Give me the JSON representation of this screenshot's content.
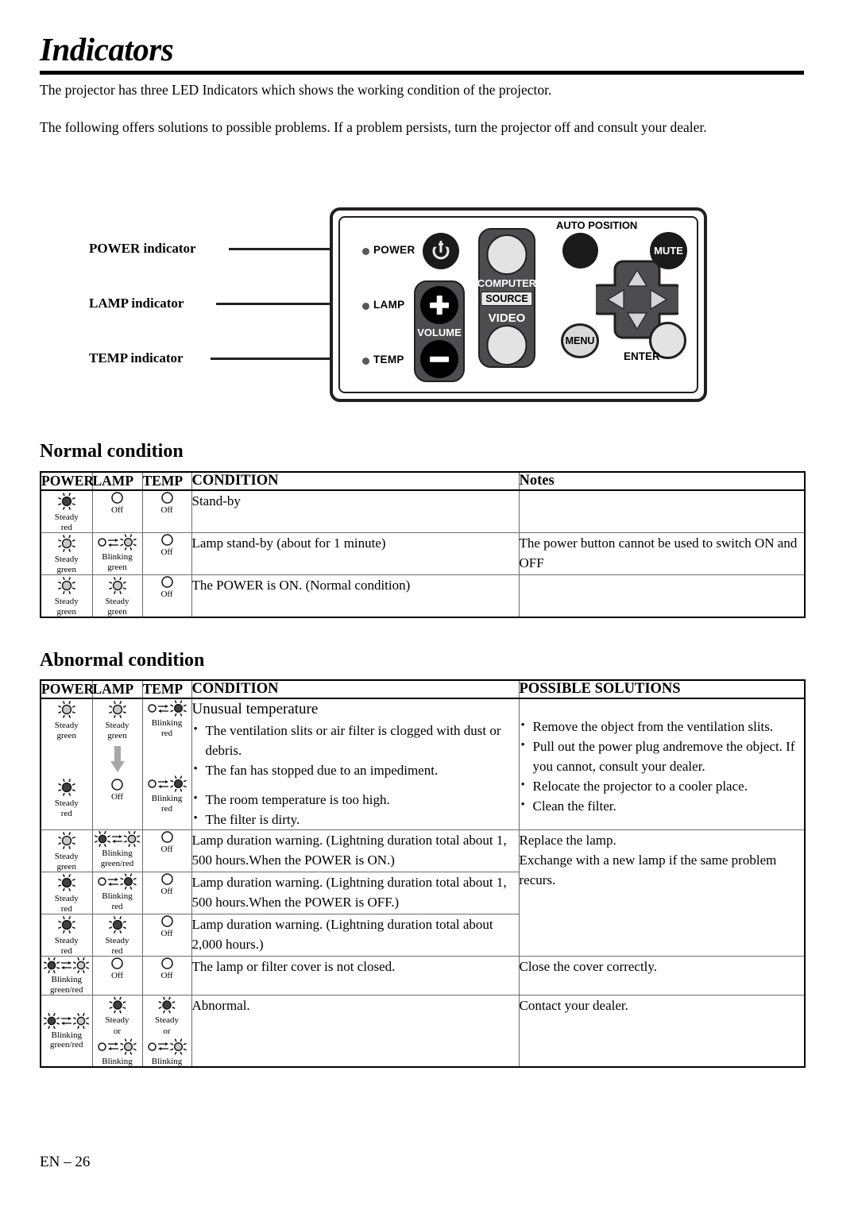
{
  "page": {
    "title": "Indicators",
    "intro1": "The projector has three LED Indicators which shows the working condition of the projector.",
    "intro2": "The following offers solutions to possible problems. If a problem persists, turn the projector off and consult your dealer.",
    "footer": "EN – 26"
  },
  "diagram": {
    "labels": {
      "power": "POWER indicator",
      "lamp": "LAMP indicator",
      "temp": "TEMP indicator"
    },
    "panel": {
      "indicator_power": "POWER",
      "indicator_lamp": "LAMP",
      "indicator_temp": "TEMP",
      "volume": "VOLUME",
      "computer": "COMPUTER",
      "source": "SOURCE",
      "video": "VIDEO",
      "auto_position": "AUTO POSITION",
      "mute": "MUTE",
      "menu": "MENU",
      "enter": "ENTER"
    }
  },
  "normal": {
    "heading": "Normal condition",
    "headers": [
      "POWER",
      "LAMP",
      "TEMP",
      "CONDITION",
      "Notes"
    ],
    "rows": [
      {
        "power": {
          "icon": "steady",
          "tone": "dark",
          "label": "Steady\nred"
        },
        "lamp": {
          "icon": "off",
          "label": "Off"
        },
        "temp": {
          "icon": "off",
          "label": "Off"
        },
        "condition": "Stand-by",
        "notes": ""
      },
      {
        "power": {
          "icon": "steady",
          "tone": "light",
          "label": "Steady\ngreen"
        },
        "lamp": {
          "icon": "blinking",
          "tone": "light",
          "label": "Blinking\ngreen"
        },
        "temp": {
          "icon": "off",
          "label": "Off"
        },
        "condition": "Lamp stand-by (about for 1 minute)",
        "notes": "The power button cannot be used to switch ON and OFF"
      },
      {
        "power": {
          "icon": "steady",
          "tone": "light",
          "label": "Steady\ngreen"
        },
        "lamp": {
          "icon": "steady",
          "tone": "light",
          "label": "Steady\ngreen"
        },
        "temp": {
          "icon": "off",
          "label": "Off"
        },
        "condition": "The POWER is ON. (Normal condition)",
        "notes": ""
      }
    ]
  },
  "abnormal": {
    "heading": "Abnormal condition",
    "headers": [
      "POWER",
      "LAMP",
      "TEMP",
      "CONDITION",
      "POSSIBLE SOLUTIONS"
    ],
    "row_temp": {
      "power_top": {
        "icon": "steady",
        "tone": "light",
        "label": "Steady\ngreen"
      },
      "lamp_top": {
        "icon": "steady",
        "tone": "light",
        "label": "Steady\ngreen"
      },
      "temp_top": {
        "icon": "blinking",
        "tone": "dark",
        "label": "Blinking\nred"
      },
      "power_bottom": {
        "icon": "steady",
        "tone": "dark",
        "label": "Steady\nred"
      },
      "lamp_bottom": {
        "icon": "off",
        "label": "Off"
      },
      "temp_bottom": {
        "icon": "blinking",
        "tone": "dark",
        "label": "Blinking\nred"
      },
      "condition_title": "Unusual temperature",
      "condition_bullets_top": [
        "The ventilation slits or air filter is clogged with dust or debris.",
        "The fan has stopped due to an impediment."
      ],
      "condition_bullets_bottom": [
        "The room temperature is too high.",
        "The filter is dirty."
      ],
      "solutions": [
        "Remove the object from the ventilation slits.",
        "Pull out the power plug andremove the object. If you cannot, consult your dealer.",
        "Relocate the projector to a cooler place.",
        "Clean the filter."
      ]
    },
    "lamp_rows": [
      {
        "power": {
          "icon": "steady",
          "tone": "light",
          "label": "Steady\ngreen"
        },
        "lamp": {
          "icon": "blinking2",
          "label": "Blinking\ngreen/red"
        },
        "temp": {
          "icon": "off",
          "label": "Off"
        },
        "condition": "Lamp duration warning. (Lightning duration total about 1, 500 hours.When the POWER is ON.)"
      },
      {
        "power": {
          "icon": "steady",
          "tone": "dark",
          "label": "Steady\nred"
        },
        "lamp": {
          "icon": "blinking",
          "tone": "dark",
          "label": "Blinking\nred"
        },
        "temp": {
          "icon": "off",
          "label": "Off"
        },
        "condition": "Lamp duration warning. (Lightning duration total about 1, 500 hours.When the POWER is OFF.)"
      },
      {
        "power": {
          "icon": "steady",
          "tone": "dark",
          "label": "Steady\nred"
        },
        "lamp": {
          "icon": "steady",
          "tone": "dark",
          "label": "Steady\nred"
        },
        "temp": {
          "icon": "off",
          "label": "Off"
        },
        "condition": "Lamp duration warning. (Lightning duration total about 2,000 hours.)"
      }
    ],
    "lamp_solution": "Replace the lamp.\nExchange with a new lamp if the same problem recurs.",
    "cover_row": {
      "power": {
        "icon": "blinking2",
        "label": "Blinking\ngreen/red"
      },
      "lamp": {
        "icon": "off",
        "label": "Off"
      },
      "temp": {
        "icon": "off",
        "label": "Off"
      },
      "condition": "The lamp or filter cover is not closed.",
      "solution": "Close the cover correctly."
    },
    "abnormal_row": {
      "power": {
        "icon": "blinking2",
        "label": "Blinking\ngreen/red"
      },
      "lamp": {
        "icon": "steady_or_blinking",
        "label_top": "Steady",
        "label_or": "or",
        "label_bottom": "Blinking"
      },
      "temp": {
        "icon": "steady_or_blinking",
        "label_top": "Steady",
        "label_or": "or",
        "label_bottom": "Blinking"
      },
      "condition": "Abnormal.",
      "solution": "Contact your dealer."
    }
  },
  "colors": {
    "ink": "#000000",
    "panel_gray": "#4d4d4f",
    "key_dark": "#1a1a1a",
    "key_light": "#e3e3e3",
    "arrow_gray": "#9a9a9a"
  }
}
